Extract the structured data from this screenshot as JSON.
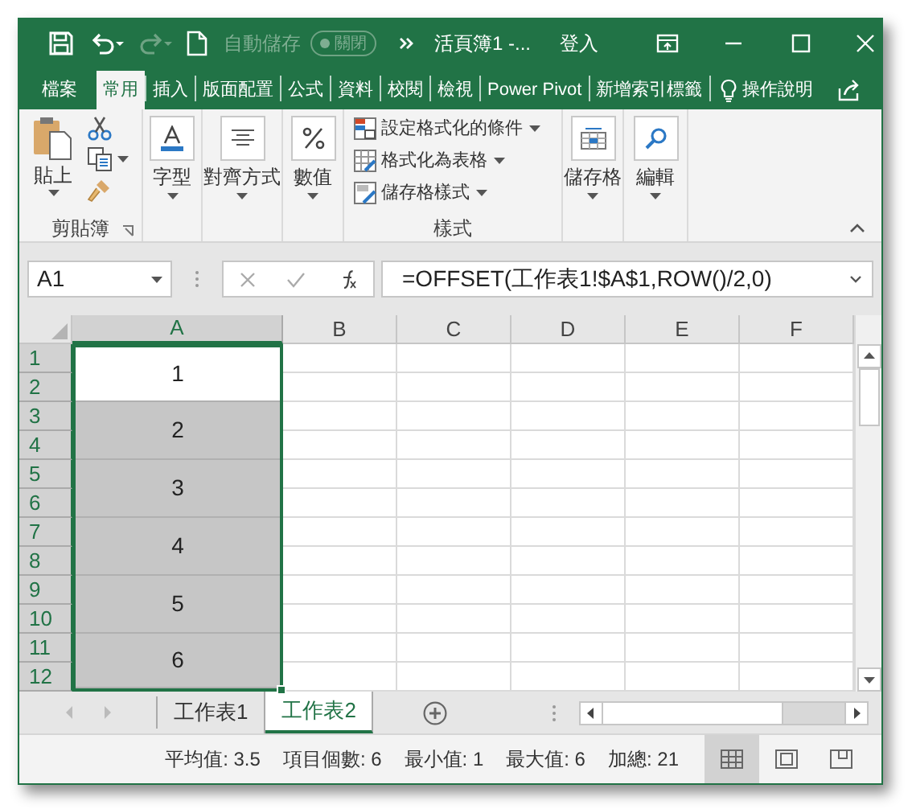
{
  "title_bar": {
    "autosave": {
      "label": "自動儲存",
      "state": "關閉",
      "on": false
    },
    "title": "活頁簿1 -...",
    "sign_in": "登入"
  },
  "ribbon_tabs": [
    {
      "label": "檔案",
      "selected": false
    },
    {
      "label": "常用",
      "selected": true
    },
    {
      "label": "插入",
      "selected": false
    },
    {
      "label": "版面配置",
      "selected": false
    },
    {
      "label": "公式",
      "selected": false
    },
    {
      "label": "資料",
      "selected": false
    },
    {
      "label": "校閱",
      "selected": false
    },
    {
      "label": "檢視",
      "selected": false
    },
    {
      "label": "Power Pivot",
      "selected": false
    },
    {
      "label": "新增索引標籤",
      "selected": false
    }
  ],
  "tell_me": "操作說明",
  "ribbon": {
    "clipboard": {
      "paste": "貼上",
      "label": "剪貼簿"
    },
    "font": "字型",
    "alignment": "對齊方式",
    "number": "數值",
    "styles": {
      "items": [
        "設定格式化的條件",
        "格式化為表格",
        "儲存格樣式"
      ],
      "label": "樣式"
    },
    "cells": "儲存格",
    "editing": "編輯"
  },
  "formula_bar": {
    "name_box": "A1",
    "formula": "=OFFSET(工作表1!$A$1,ROW()/2,0)"
  },
  "grid": {
    "columns": [
      {
        "label": "A",
        "selected": true
      },
      {
        "label": "B",
        "selected": false
      },
      {
        "label": "C",
        "selected": false
      },
      {
        "label": "D",
        "selected": false
      },
      {
        "label": "E",
        "selected": false
      },
      {
        "label": "F",
        "selected": false
      }
    ],
    "rows": [
      {
        "label": "1",
        "selected": true
      },
      {
        "label": "2",
        "selected": true
      },
      {
        "label": "3",
        "selected": true
      },
      {
        "label": "4",
        "selected": true
      },
      {
        "label": "5",
        "selected": true
      },
      {
        "label": "6",
        "selected": true
      },
      {
        "label": "7",
        "selected": true
      },
      {
        "label": "8",
        "selected": true
      },
      {
        "label": "9",
        "selected": true
      },
      {
        "label": "10",
        "selected": true
      },
      {
        "label": "11",
        "selected": true
      },
      {
        "label": "12",
        "selected": true
      }
    ],
    "merged_cells": [
      {
        "value": "1",
        "active": true
      },
      {
        "value": "2",
        "active": false
      },
      {
        "value": "3",
        "active": false
      },
      {
        "value": "4",
        "active": false
      },
      {
        "value": "5",
        "active": false
      },
      {
        "value": "6",
        "active": false
      }
    ]
  },
  "sheet_tabs": [
    {
      "label": "工作表1",
      "selected": false
    },
    {
      "label": "工作表2",
      "selected": true
    }
  ],
  "status_bar": {
    "stats": [
      "平均值: 3.5",
      "項目個數: 6",
      "最小值: 1",
      "最大值: 6",
      "加總: 21"
    ],
    "views": [
      {
        "kind": "normal",
        "selected": true
      },
      {
        "kind": "page_layout",
        "selected": false
      },
      {
        "kind": "page_break",
        "selected": false
      }
    ]
  }
}
